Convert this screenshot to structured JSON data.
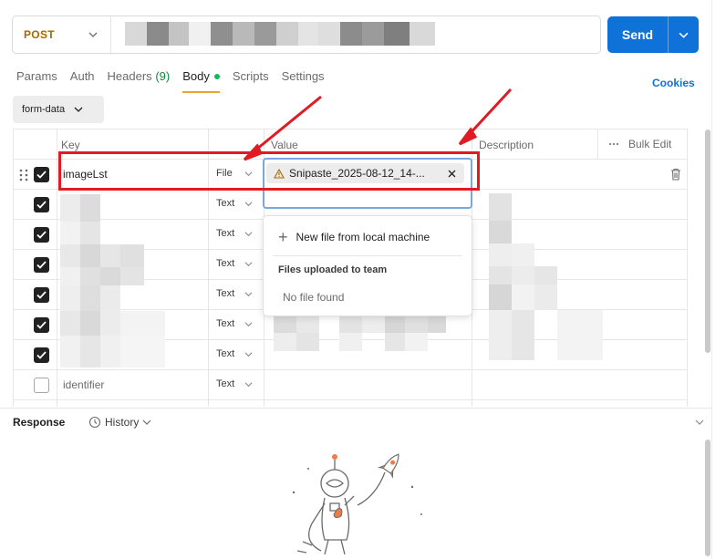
{
  "request": {
    "method": "POST",
    "send_label": "Send"
  },
  "tabs": [
    {
      "label": "Params"
    },
    {
      "label": "Auth"
    },
    {
      "label": "Headers",
      "count": "(9)"
    },
    {
      "label": "Body"
    },
    {
      "label": "Scripts"
    },
    {
      "label": "Settings"
    }
  ],
  "cookies_label": "Cookies",
  "body_mode": "form-data",
  "table": {
    "headers": {
      "key": "Key",
      "value": "Value",
      "description": "Description",
      "bulk_edit": "Bulk Edit"
    },
    "rows": [
      {
        "key": "imageLst",
        "type": "File",
        "checked": true
      },
      {
        "key": "",
        "type": "Text",
        "checked": true
      },
      {
        "key": "",
        "type": "Text",
        "checked": true
      },
      {
        "key": "",
        "type": "Text",
        "checked": true
      },
      {
        "key": "",
        "type": "Text",
        "checked": true
      },
      {
        "key": "",
        "type": "Text",
        "checked": true
      },
      {
        "key": "",
        "type": "Text",
        "checked": true
      },
      {
        "key": "identifier",
        "type": "Text",
        "checked": false
      }
    ]
  },
  "file_chip": {
    "name": "Snipaste_2025-08-12_14-..."
  },
  "dropdown": {
    "new_file": "New file from local machine",
    "section": "Files uploaded to team",
    "empty": "No file found"
  },
  "response": {
    "label": "Response",
    "history": "History"
  },
  "colors": {
    "accent": "#0f72d9",
    "method": "#a36a00",
    "annotation": "#e01b24",
    "active_tab": "#e8a43c"
  }
}
